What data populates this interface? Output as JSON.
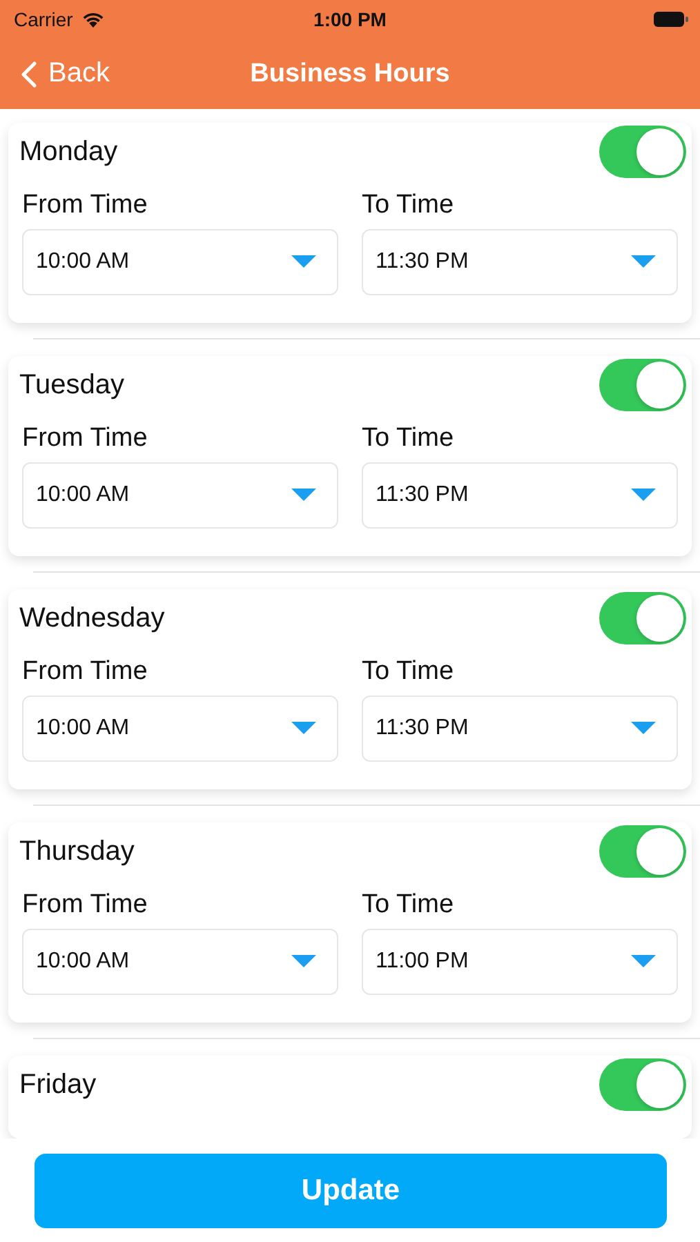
{
  "status_bar": {
    "carrier": "Carrier",
    "time": "1:00 PM"
  },
  "nav": {
    "back": "Back",
    "title": "Business Hours"
  },
  "days": [
    {
      "day": "Monday",
      "on": true,
      "from_label": "From Time",
      "from": "10:00 AM",
      "to_label": "To Time",
      "to": "11:30 PM"
    },
    {
      "day": "Tuesday",
      "on": true,
      "from_label": "From Time",
      "from": "10:00 AM",
      "to_label": "To Time",
      "to": "11:30 PM"
    },
    {
      "day": "Wednesday",
      "on": true,
      "from_label": "From Time",
      "from": "10:00 AM",
      "to_label": "To Time",
      "to": "11:30 PM"
    },
    {
      "day": "Thursday",
      "on": true,
      "from_label": "From Time",
      "from": "10:00 AM",
      "to_label": "To Time",
      "to": "11:00 PM"
    },
    {
      "day": "Friday",
      "on": true
    }
  ],
  "update_button": "Update"
}
